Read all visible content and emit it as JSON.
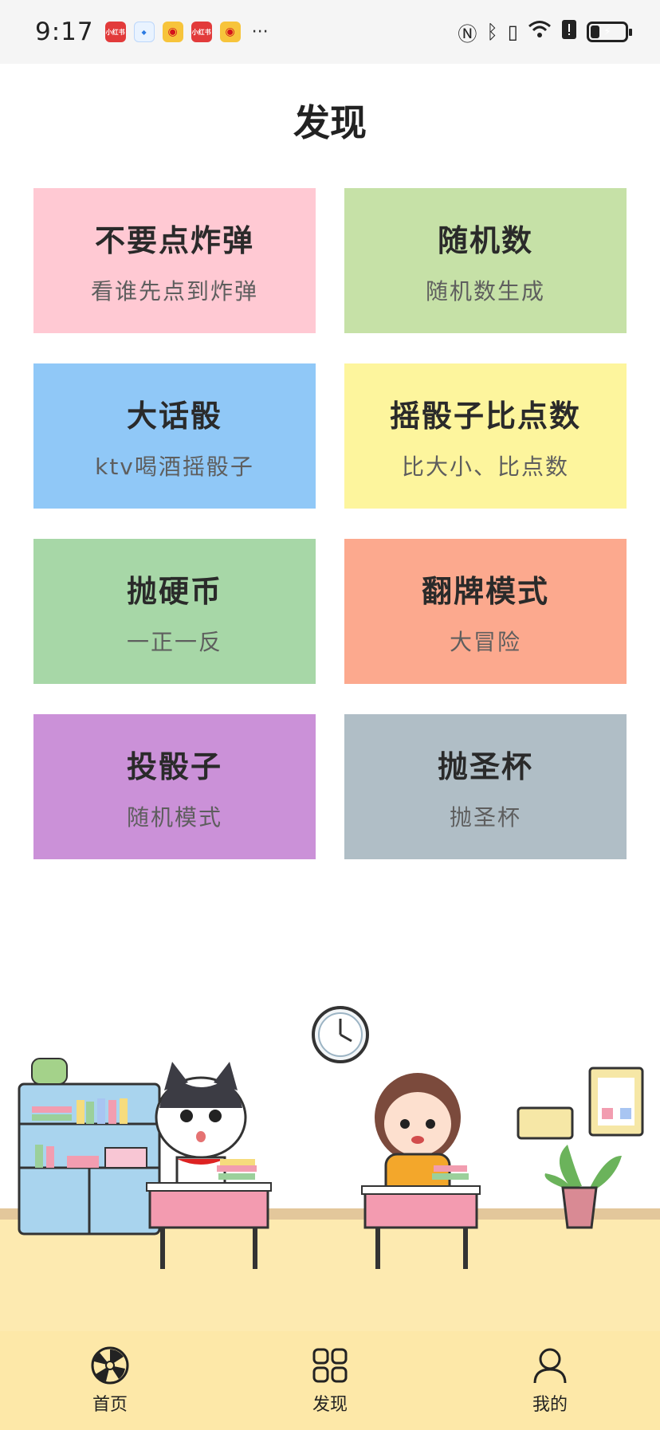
{
  "status_bar": {
    "time": "9:17",
    "app_icons": [
      "xiaohongshu-icon",
      "baidu-netdisk-icon",
      "weibo-icon",
      "xiaohongshu-icon",
      "weibo-icon"
    ],
    "more": "···"
  },
  "page": {
    "title": "发现"
  },
  "cards": [
    {
      "title": "不要点炸弹",
      "subtitle": "看谁先点到炸弹",
      "color": "#ffc9d3"
    },
    {
      "title": "随机数",
      "subtitle": "随机数生成",
      "color": "#c6e1a7"
    },
    {
      "title": "大话骰",
      "subtitle": "ktv喝酒摇骰子",
      "color": "#90c8f7"
    },
    {
      "title": "摇骰子比点数",
      "subtitle": "比大小、比点数",
      "color": "#fdf59d"
    },
    {
      "title": "抛硬币",
      "subtitle": "一正一反",
      "color": "#a7d7a7"
    },
    {
      "title": "翻牌模式",
      "subtitle": "大冒险",
      "color": "#fca98e"
    },
    {
      "title": "投骰子",
      "subtitle": "随机模式",
      "color": "#cb91d8"
    },
    {
      "title": "抛圣杯",
      "subtitle": "抛圣杯",
      "color": "#b0bec6"
    }
  ],
  "bottom_nav": {
    "items": [
      {
        "label": "首页",
        "icon": "wheel-icon"
      },
      {
        "label": "发现",
        "icon": "grid-icon"
      },
      {
        "label": "我的",
        "icon": "user-icon"
      }
    ]
  },
  "colors": {
    "nav_bg": "#fde8a8",
    "floor": "#fdeab0",
    "wall_stripe": "#e3c79b"
  }
}
